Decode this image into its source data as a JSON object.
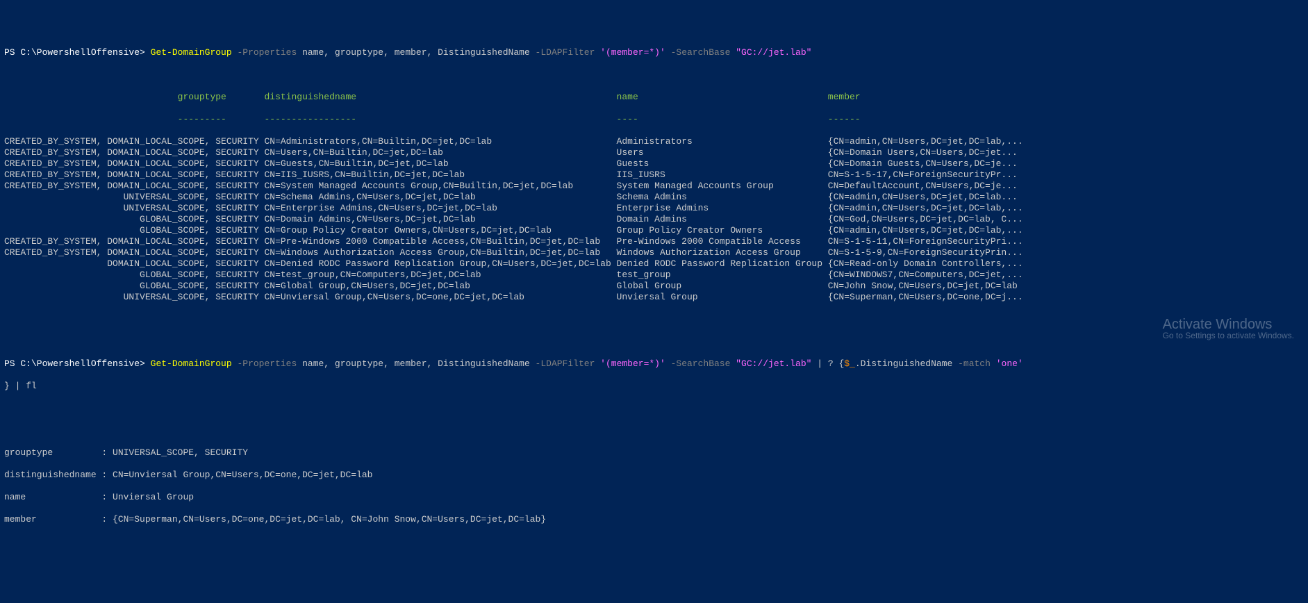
{
  "prompt1": {
    "path": "PS C:\\PowershellOffensive> ",
    "cmd": "Get-DomainGroup",
    "flag1": " -Properties ",
    "args1": "name, grouptype, member, DistinguishedName",
    "flag2": " -LDAPFilter ",
    "str1": "'(member=*)'",
    "flag3": " -SearchBase ",
    "str2": "\"GC://jet.lab\""
  },
  "header": {
    "indent": "                                ",
    "grouptype": "grouptype",
    "distinguishedname": "distinguishedname",
    "name": "name",
    "member": "member",
    "u_grouptype": "---------",
    "u_dn": "-----------------",
    "u_name": "----",
    "u_member": "------"
  },
  "rows": [
    {
      "gt": "CREATED_BY_SYSTEM, DOMAIN_LOCAL_SCOPE, SECURITY",
      "dn": "CN=Administrators,CN=Builtin,DC=jet,DC=lab",
      "name": "Administrators",
      "member": "{CN=admin,CN=Users,DC=jet,DC=lab,..."
    },
    {
      "gt": "CREATED_BY_SYSTEM, DOMAIN_LOCAL_SCOPE, SECURITY",
      "dn": "CN=Users,CN=Builtin,DC=jet,DC=lab",
      "name": "Users",
      "member": "{CN=Domain Users,CN=Users,DC=jet..."
    },
    {
      "gt": "CREATED_BY_SYSTEM, DOMAIN_LOCAL_SCOPE, SECURITY",
      "dn": "CN=Guests,CN=Builtin,DC=jet,DC=lab",
      "name": "Guests",
      "member": "{CN=Domain Guests,CN=Users,DC=je..."
    },
    {
      "gt": "CREATED_BY_SYSTEM, DOMAIN_LOCAL_SCOPE, SECURITY",
      "dn": "CN=IIS_IUSRS,CN=Builtin,DC=jet,DC=lab",
      "name": "IIS_IUSRS",
      "member": "CN=S-1-5-17,CN=ForeignSecurityPr..."
    },
    {
      "gt": "CREATED_BY_SYSTEM, DOMAIN_LOCAL_SCOPE, SECURITY",
      "dn": "CN=System Managed Accounts Group,CN=Builtin,DC=jet,DC=lab",
      "name": "System Managed Accounts Group",
      "member": "CN=DefaultAccount,CN=Users,DC=je..."
    },
    {
      "gt": "                      UNIVERSAL_SCOPE, SECURITY",
      "dn": "CN=Schema Admins,CN=Users,DC=jet,DC=lab",
      "name": "Schema Admins",
      "member": "{CN=admin,CN=Users,DC=jet,DC=lab..."
    },
    {
      "gt": "                      UNIVERSAL_SCOPE, SECURITY",
      "dn": "CN=Enterprise Admins,CN=Users,DC=jet,DC=lab",
      "name": "Enterprise Admins",
      "member": "{CN=admin,CN=Users,DC=jet,DC=lab,..."
    },
    {
      "gt": "                         GLOBAL_SCOPE, SECURITY",
      "dn": "CN=Domain Admins,CN=Users,DC=jet,DC=lab",
      "name": "Domain Admins",
      "member": "{CN=God,CN=Users,DC=jet,DC=lab, C..."
    },
    {
      "gt": "                         GLOBAL_SCOPE, SECURITY",
      "dn": "CN=Group Policy Creator Owners,CN=Users,DC=jet,DC=lab",
      "name": "Group Policy Creator Owners",
      "member": "{CN=admin,CN=Users,DC=jet,DC=lab,..."
    },
    {
      "gt": "CREATED_BY_SYSTEM, DOMAIN_LOCAL_SCOPE, SECURITY",
      "dn": "CN=Pre-Windows 2000 Compatible Access,CN=Builtin,DC=jet,DC=lab",
      "name": "Pre-Windows 2000 Compatible Access",
      "member": "CN=S-1-5-11,CN=ForeignSecurityPri..."
    },
    {
      "gt": "CREATED_BY_SYSTEM, DOMAIN_LOCAL_SCOPE, SECURITY",
      "dn": "CN=Windows Authorization Access Group,CN=Builtin,DC=jet,DC=lab",
      "name": "Windows Authorization Access Group",
      "member": "CN=S-1-5-9,CN=ForeignSecurityPrin..."
    },
    {
      "gt": "                   DOMAIN_LOCAL_SCOPE, SECURITY",
      "dn": "CN=Denied RODC Password Replication Group,CN=Users,DC=jet,DC=lab",
      "name": "Denied RODC Password Replication Group",
      "member": "{CN=Read-only Domain Controllers,..."
    },
    {
      "gt": "                         GLOBAL_SCOPE, SECURITY",
      "dn": "CN=test_group,CN=Computers,DC=jet,DC=lab",
      "name": "test_group",
      "member": "{CN=WINDOWS7,CN=Computers,DC=jet,..."
    },
    {
      "gt": "                         GLOBAL_SCOPE, SECURITY",
      "dn": "CN=Global Group,CN=Users,DC=jet,DC=lab",
      "name": "Global Group",
      "member": "CN=John Snow,CN=Users,DC=jet,DC=lab"
    },
    {
      "gt": "                      UNIVERSAL_SCOPE, SECURITY",
      "dn": "CN=Unviersal Group,CN=Users,DC=one,DC=jet,DC=lab",
      "name": "Unviersal Group",
      "member": "{CN=Superman,CN=Users,DC=one,DC=j..."
    }
  ],
  "col_widths": {
    "gt": 48,
    "dn": 65,
    "name": 39
  },
  "prompt2": {
    "path": "PS C:\\PowershellOffensive> ",
    "cmd": "Get-DomainGroup",
    "flag1": " -Properties ",
    "args1": "name, grouptype, member, DistinguishedName",
    "flag2": " -LDAPFilter ",
    "str1": "'(member=*)'",
    "flag3": " -SearchBase ",
    "str2": "\"GC://jet.lab\"",
    "pipe": " | ? {",
    "var": "$_",
    "method": ".DistinguishedName",
    "flag4": " -match ",
    "str3": "'one'",
    "cont": "} | fl"
  },
  "fl": {
    "line1": "grouptype         : UNIVERSAL_SCOPE, SECURITY",
    "line2": "distinguishedname : CN=Unviersal Group,CN=Users,DC=one,DC=jet,DC=lab",
    "line3": "name              : Unviersal Group",
    "line4": "member            : {CN=Superman,CN=Users,DC=one,DC=jet,DC=lab, CN=John Snow,CN=Users,DC=jet,DC=lab}"
  },
  "watermark": {
    "title": "Activate Windows",
    "sub": "Go to Settings to activate Windows."
  }
}
